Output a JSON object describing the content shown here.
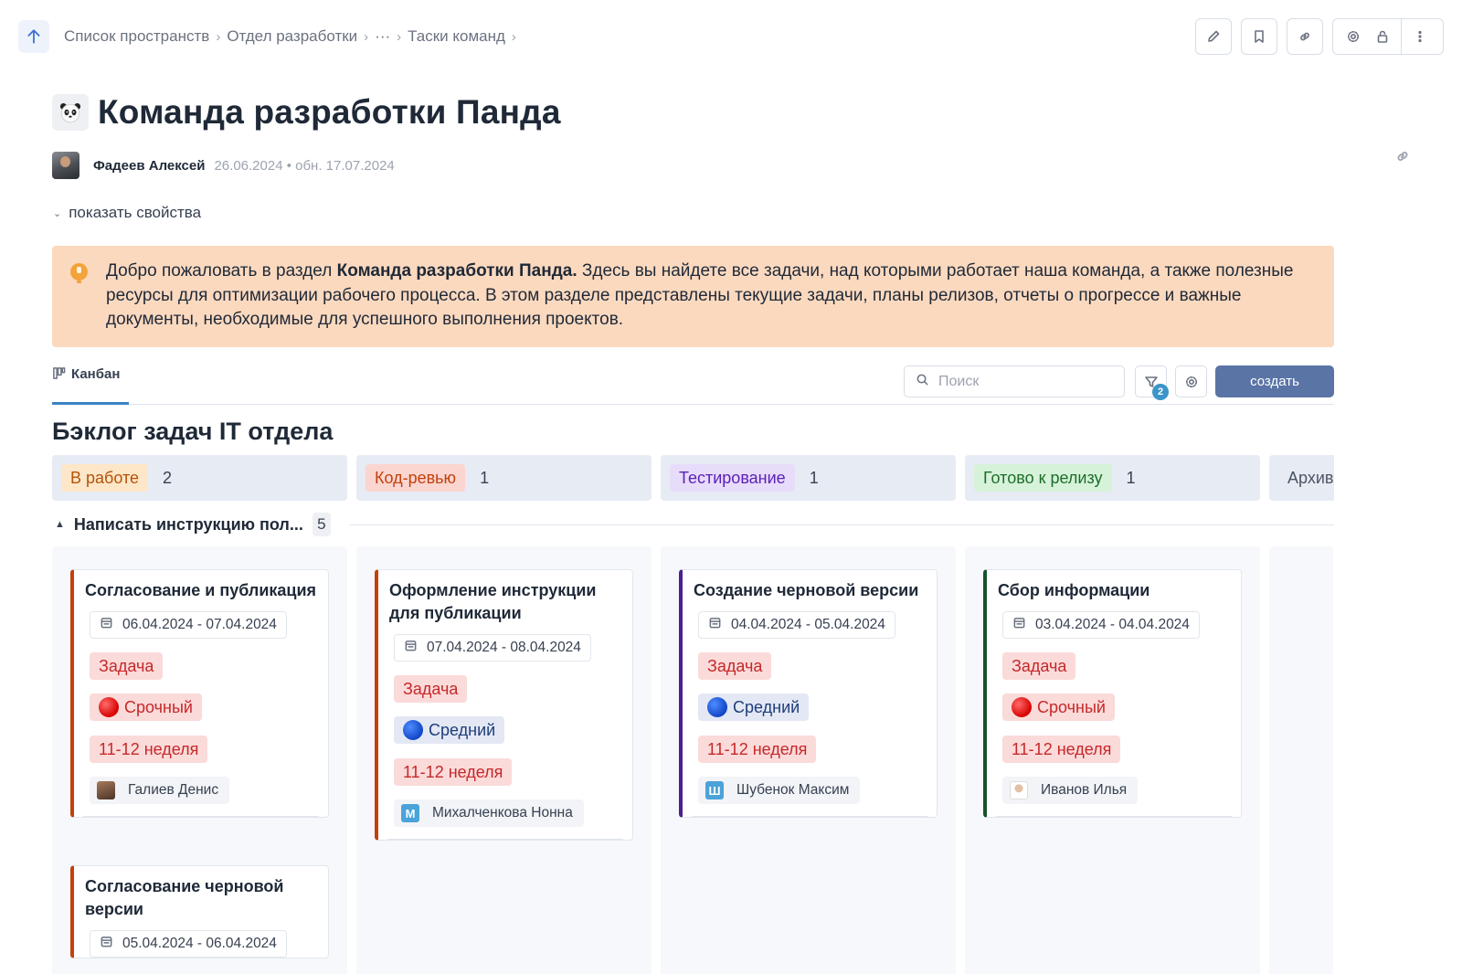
{
  "breadcrumb": [
    "Список пространств",
    "Отдел разработки",
    "···",
    "Таски команд"
  ],
  "page": {
    "title": "Команда разработки Панда",
    "author": "Фадеев Алексей",
    "dates": "26.06.2024 • обн. 17.07.2024",
    "show_props": "показать свойства"
  },
  "callout": {
    "intro": "Добро пожаловать в раздел ",
    "bold": "Команда разработки Панда.",
    "rest": " Здесь вы найдете все задачи, над которыми работает наша команда, а также полезные ресурсы для оптимизации рабочего процесса. В этом разделе представлены текущие задачи, планы релизов, отчеты о прогрессе и важные документы, необходимые для успешного выполнения проектов."
  },
  "toolbar": {
    "tab_label": "Канбан",
    "search_placeholder": "Поиск",
    "filter_count": "2",
    "create_label": "создать"
  },
  "board": {
    "title": "Бэклог задач IT отдела",
    "columns": [
      {
        "label": "В работе",
        "count": "2",
        "bg": "#fde7c8",
        "fg": "#b45309"
      },
      {
        "label": "Код-ревью",
        "count": "1",
        "bg": "#fbd5d0",
        "fg": "#c2410c"
      },
      {
        "label": "Тестирование",
        "count": "1",
        "bg": "#e8dcfb",
        "fg": "#5b21b6"
      },
      {
        "label": "Готово к релизу",
        "count": "1",
        "bg": "#d6f3d9",
        "fg": "#1f6d2b"
      },
      {
        "label": "Архив",
        "count": "",
        "bg": "transparent",
        "fg": "#4b5563"
      }
    ],
    "group": {
      "name": "Написать инструкцию пол...",
      "count": "5"
    },
    "cards": [
      {
        "title": "Согласование и публикация",
        "dates": "06.04.2024 - 07.04.2024",
        "type": "Задача",
        "priority": "Срочный",
        "week": "11-12 неделя",
        "assignee": "Галиев Денис",
        "avatar_letter": "",
        "accent": "#c2410c"
      },
      {
        "title": "Согласование черновой версии",
        "dates": "05.04.2024 - 06.04.2024",
        "accent": "#c2410c"
      },
      {
        "title": "Оформление инструкции для публикации",
        "dates": "07.04.2024 - 08.04.2024",
        "type": "Задача",
        "priority": "Средний",
        "week": "11-12 неделя",
        "assignee": "Михалченкова Нонна",
        "avatar_letter": "М",
        "accent": "#c2410c"
      },
      {
        "title": "Создание черновой версии",
        "dates": "04.04.2024 - 05.04.2024",
        "type": "Задача",
        "priority": "Средний",
        "week": "11-12 неделя",
        "assignee": "Шубенок Максим",
        "avatar_letter": "Ш",
        "accent": "#4c1d95"
      },
      {
        "title": "Сбор информации",
        "dates": "03.04.2024 - 04.04.2024",
        "type": "Задача",
        "priority": "Срочный",
        "week": "11-12 неделя",
        "assignee": "Иванов Илья",
        "avatar_letter": "",
        "accent": "#14532d"
      }
    ]
  },
  "icons": {
    "up": "arrow-up-icon",
    "edit": "pencil-icon",
    "bookmark": "bookmark-icon",
    "link": "link-icon",
    "settings": "gear-icon",
    "lock": "lock-icon",
    "more": "more-vertical-icon",
    "calendar": "calendar-icon",
    "search": "search-icon",
    "filter": "filter-icon",
    "kanban": "kanban-icon"
  }
}
